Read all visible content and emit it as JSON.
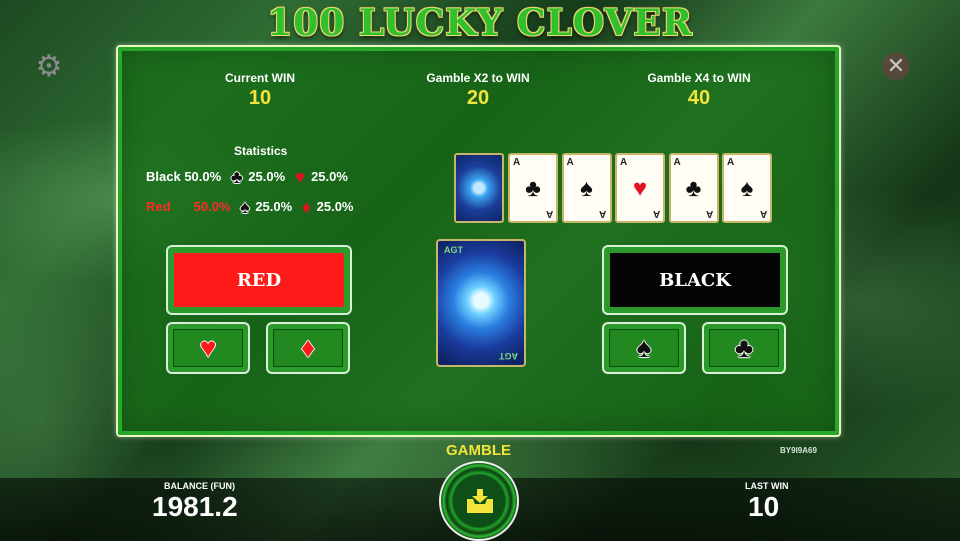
{
  "title": "100 LUCKY CLOVER",
  "panel": {
    "current_win": {
      "label": "Current WIN",
      "value": "10"
    },
    "gamble_x2": {
      "label": "Gamble X2 to WIN",
      "value": "20"
    },
    "gamble_x4": {
      "label": "Gamble X4 to WIN",
      "value": "40"
    },
    "statistics": {
      "title": "Statistics",
      "black": {
        "label": "Black",
        "percent": "50.0%",
        "suit1_pct": "25.0%",
        "suit2_pct": "25.0%"
      },
      "red": {
        "label": "Red",
        "percent": "50.0%",
        "suit1_pct": "25.0%",
        "suit2_pct": "25.0%"
      }
    },
    "history_cards": [
      {
        "rank": "A",
        "suit": "♣",
        "color": "#111111"
      },
      {
        "rank": "A",
        "suit": "♠",
        "color": "#111111"
      },
      {
        "rank": "A",
        "suit": "♥",
        "color": "#e0141e"
      },
      {
        "rank": "A",
        "suit": "♣",
        "color": "#111111"
      },
      {
        "rank": "A",
        "suit": "♠",
        "color": "#111111"
      }
    ],
    "card_back_text": "AGT",
    "red_button": "RED",
    "black_button": "BLACK",
    "suits": {
      "heart": "♥",
      "diamond": "♦",
      "spade": "♠",
      "club": "♣"
    }
  },
  "build_code": "BY9I9A69",
  "footer": {
    "balance_label": "BALANCE (FUN)",
    "balance_value": "1981.2",
    "gamble_label": "GAMBLE",
    "last_win_label": "LAST WIN",
    "last_win_value": "10"
  },
  "icons": {
    "settings": "gear-icon",
    "close": "close-icon",
    "collect": "collect-icon"
  },
  "colors": {
    "accent_yellow": "#f3e43c",
    "red": "#ff1a1a",
    "panel_green": "#1f8a1f"
  }
}
